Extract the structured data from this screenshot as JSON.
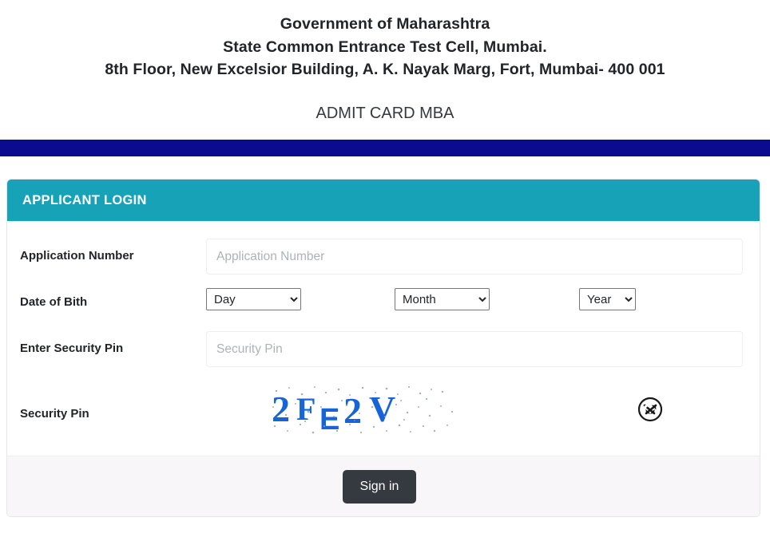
{
  "header": {
    "org_line1": "Government of Maharashtra",
    "org_line2": "State Common Entrance Test Cell, Mumbai.",
    "org_line3": "8th Floor, New Excelsior Building, A. K. Nayak Marg, Fort, Mumbai- 400 001",
    "admit_title": "ADMIT CARD MBA",
    "bar_color": "#0b0b8f"
  },
  "card": {
    "title": "APPLICANT LOGIN",
    "header_color": "#17a2b8"
  },
  "form": {
    "application_number": {
      "label": "Application Number",
      "placeholder": "Application Number",
      "value": ""
    },
    "date_of_birth": {
      "label": "Date of Bith",
      "day": {
        "selected": "Day",
        "options": [
          "Day"
        ]
      },
      "month": {
        "selected": "Month",
        "options": [
          "Month"
        ]
      },
      "year": {
        "selected": "Year",
        "options": [
          "Year"
        ]
      }
    },
    "enter_security_pin": {
      "label": "Enter Security Pin",
      "placeholder": "Security Pin",
      "value": ""
    },
    "security_pin": {
      "label": "Security Pin",
      "captcha_text": "2FE2V",
      "captcha_color": "#1565d8",
      "refresh_icon": "refresh-captcha-icon"
    }
  },
  "footer": {
    "signin_label": "Sign in"
  }
}
